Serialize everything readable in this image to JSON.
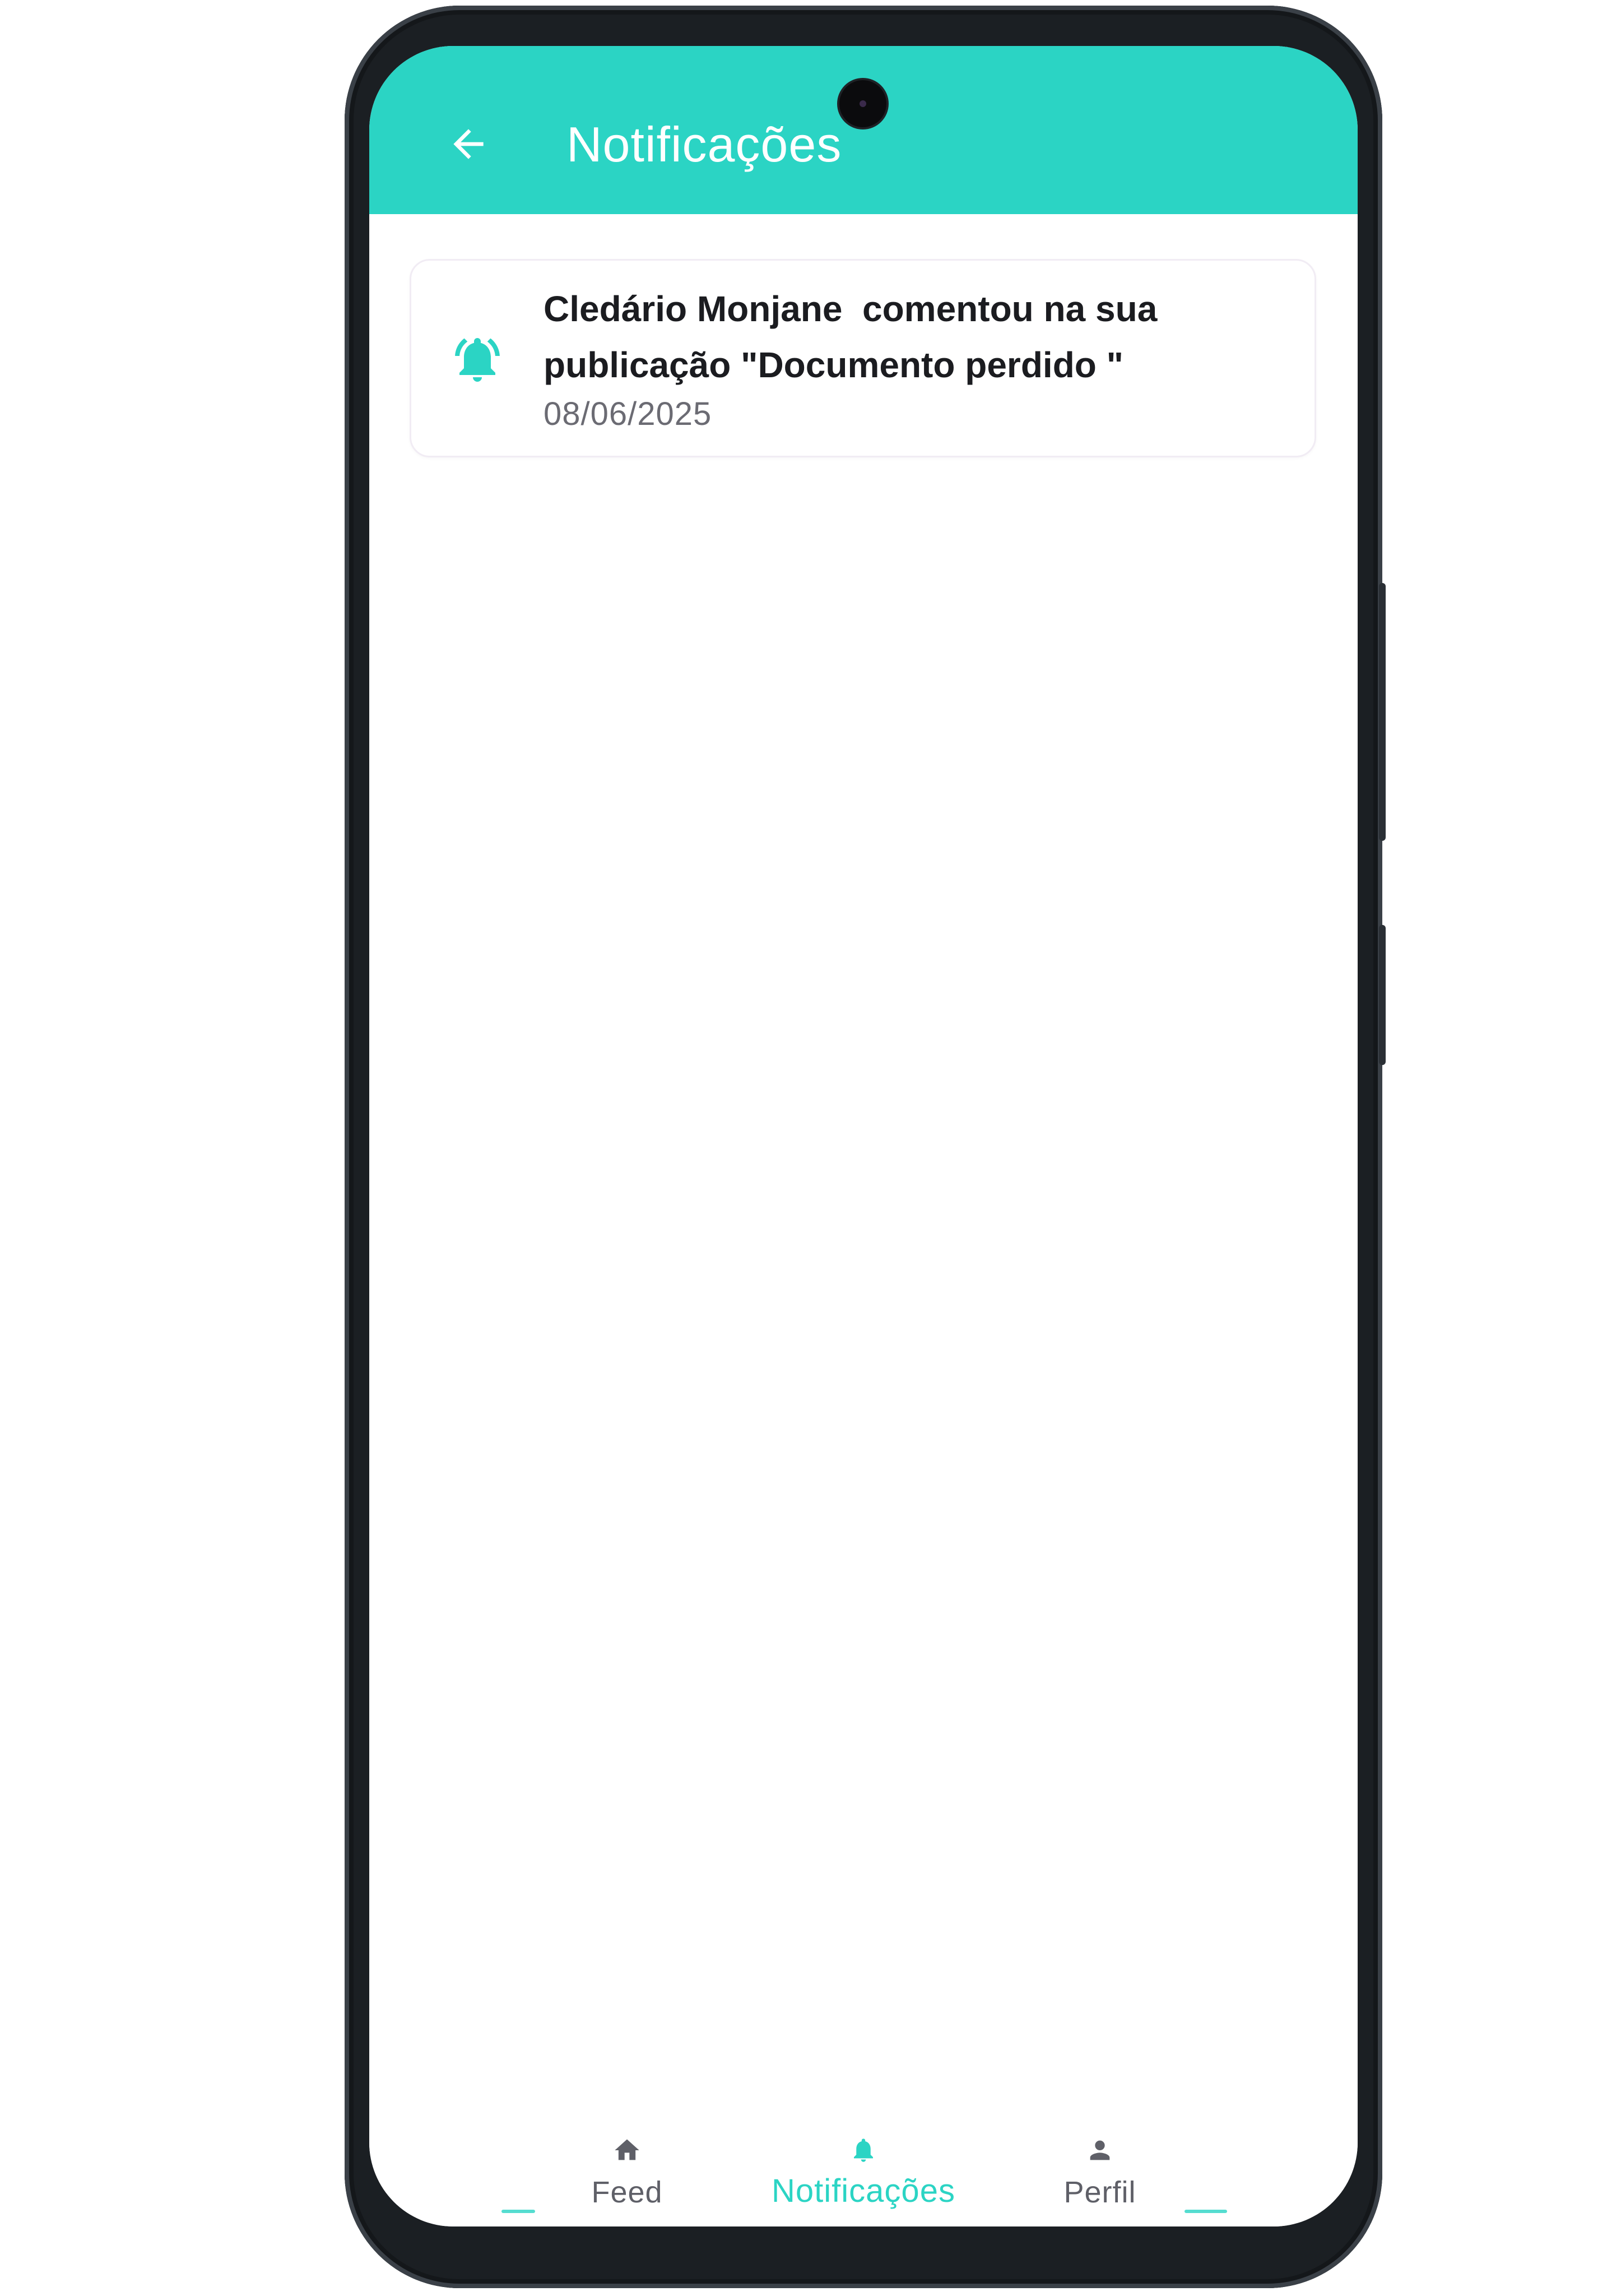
{
  "app_bar": {
    "title": "Notificações",
    "back_icon": "arrow-left-icon",
    "background_color": "#2bd4c4"
  },
  "notifications": [
    {
      "icon": "bell-ringing-icon",
      "message": "Cledário Monjane  comentou na sua publicação \"Documento perdido \"",
      "date": "08/06/2025"
    }
  ],
  "bottom_nav": {
    "items": [
      {
        "label": "Feed",
        "icon": "home-icon",
        "active": false
      },
      {
        "label": "Notificações",
        "icon": "bell-icon",
        "active": true
      },
      {
        "label": "Perfil",
        "icon": "person-icon",
        "active": false
      }
    ],
    "active_color": "#2bd4c4",
    "inactive_color": "#5f6068"
  }
}
